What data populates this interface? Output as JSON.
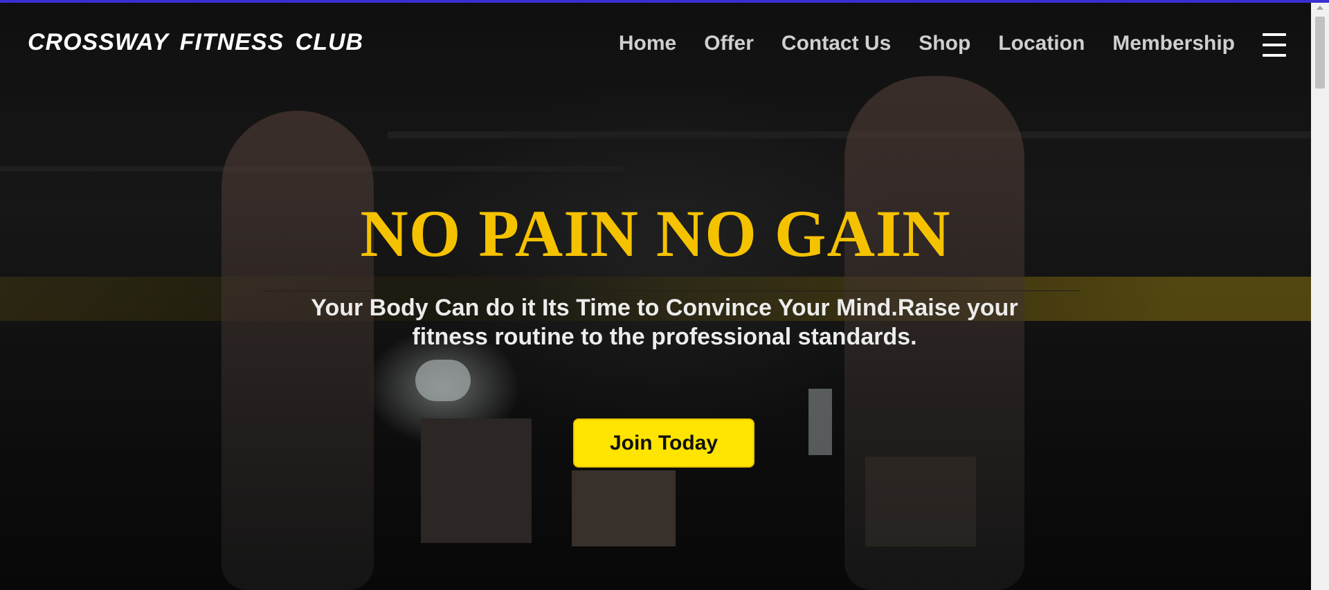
{
  "brand": {
    "name": "CROSSWAY FITNESS CLUB"
  },
  "nav": {
    "items": [
      {
        "label": "Home"
      },
      {
        "label": "Offer"
      },
      {
        "label": "Contact Us"
      },
      {
        "label": "Shop"
      },
      {
        "label": "Location"
      },
      {
        "label": "Membership"
      }
    ],
    "menu_icon": "hamburger-menu-icon"
  },
  "hero": {
    "headline": "NO PAIN NO GAIN",
    "subtitle": "Your Body Can do it Its Time to Convince Your Mind.Raise your fitness routine to the professional standards.",
    "cta_label": "Join Today",
    "background": "gym-battle-ropes-photo"
  },
  "colors": {
    "headline": "#f5c200",
    "cta_background": "#ffe400",
    "top_accent": "#3a2fd0"
  }
}
